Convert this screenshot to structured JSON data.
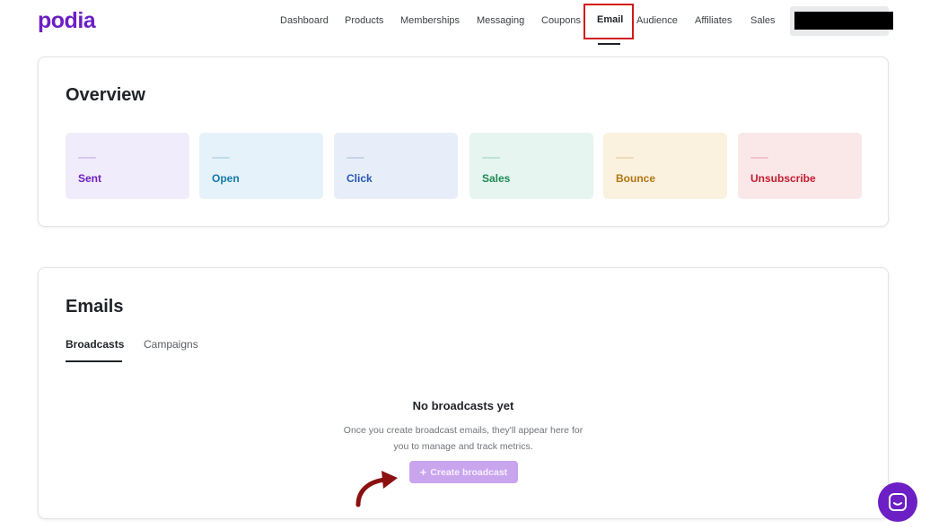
{
  "brand": {
    "logo_text": "podia",
    "color": "#6c1fc4"
  },
  "nav": {
    "items": [
      {
        "label": "Dashboard"
      },
      {
        "label": "Products"
      },
      {
        "label": "Memberships"
      },
      {
        "label": "Messaging"
      },
      {
        "label": "Coupons"
      },
      {
        "label": "Email",
        "active": true
      },
      {
        "label": "Audience"
      },
      {
        "label": "Affiliates"
      },
      {
        "label": "Sales"
      }
    ]
  },
  "overview": {
    "title": "Overview",
    "metrics": [
      {
        "label": "Sent",
        "bg": "#f1ecfb",
        "color": "#6c1fc4"
      },
      {
        "label": "Open",
        "bg": "#e6f2fa",
        "color": "#137aa7"
      },
      {
        "label": "Click",
        "bg": "#e8eef9",
        "color": "#2757b4"
      },
      {
        "label": "Sales",
        "bg": "#e6f5ef",
        "color": "#1d8a55"
      },
      {
        "label": "Bounce",
        "bg": "#fbf1df",
        "color": "#b27611"
      },
      {
        "label": "Unsubscribe",
        "bg": "#fae8e9",
        "color": "#c31b2f"
      }
    ]
  },
  "emails": {
    "title": "Emails",
    "tabs": [
      {
        "label": "Broadcasts",
        "active": true
      },
      {
        "label": "Campaigns",
        "active": false
      }
    ],
    "empty_state": {
      "title": "No broadcasts yet",
      "description": "Once you create broadcast emails, they'll appear here for you to manage and track metrics.",
      "button_label": "Create broadcast",
      "button_icon": "plus-icon"
    }
  },
  "chat": {
    "icon": "chat-icon"
  }
}
